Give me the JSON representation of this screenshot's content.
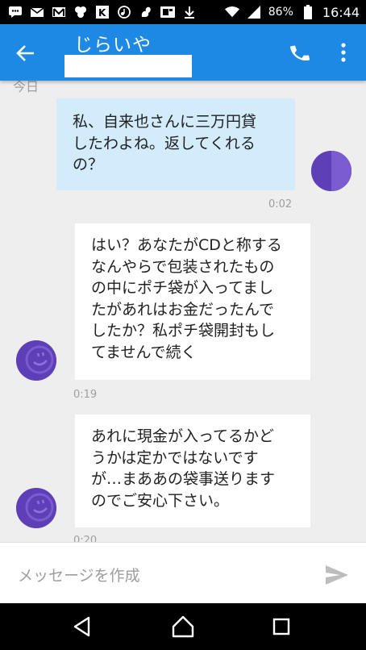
{
  "status_bar": {
    "battery_percent": "86%",
    "time": "16:44",
    "icons": [
      "message-icon",
      "mail-icon",
      "gmail-icon",
      "cluster-icon",
      "k-app-icon",
      "music-icon",
      "squirrel-icon",
      "card-icon",
      "download-icon",
      "wifi-icon",
      "signal-icon",
      "battery-icon"
    ]
  },
  "app_bar": {
    "title": "じらいや",
    "back_icon": "arrow-left-icon",
    "call_icon": "phone-icon",
    "more_icon": "more-vert-icon"
  },
  "messages": {
    "date_divider": "今日",
    "items": [
      {
        "direction": "outgoing",
        "lines": [
          "私、自来也さんに三万円貸",
          "したわよね。返してくれる",
          "の？"
        ],
        "time": "0:02"
      },
      {
        "direction": "incoming",
        "lines": [
          "はい？あなたがCDと称する",
          "なんやらで包装されたもの",
          "の中にポチ袋が入ってまし",
          "たがあれはお金だったんで",
          "したか？私ポチ袋開封もし",
          "てませんで続く"
        ],
        "time": "0:19"
      },
      {
        "direction": "incoming",
        "lines": [
          "あれに現金が入ってるかど",
          "うかは定かではないです",
          "が…まああの袋事送ります",
          "のでご安心下さい。"
        ],
        "time": "0:20"
      }
    ]
  },
  "compose": {
    "placeholder": "メッセージを作成",
    "send_icon": "send-icon"
  },
  "nav_bar": {
    "icons": [
      "nav-back-icon",
      "nav-home-icon",
      "nav-recents-icon"
    ]
  },
  "colors": {
    "app_bar": "#1e88e5",
    "outgoing_bubble": "#d3ecfb",
    "incoming_bubble": "#ffffff",
    "avatar": "#5e3fb8",
    "background": "#eeeeee"
  }
}
